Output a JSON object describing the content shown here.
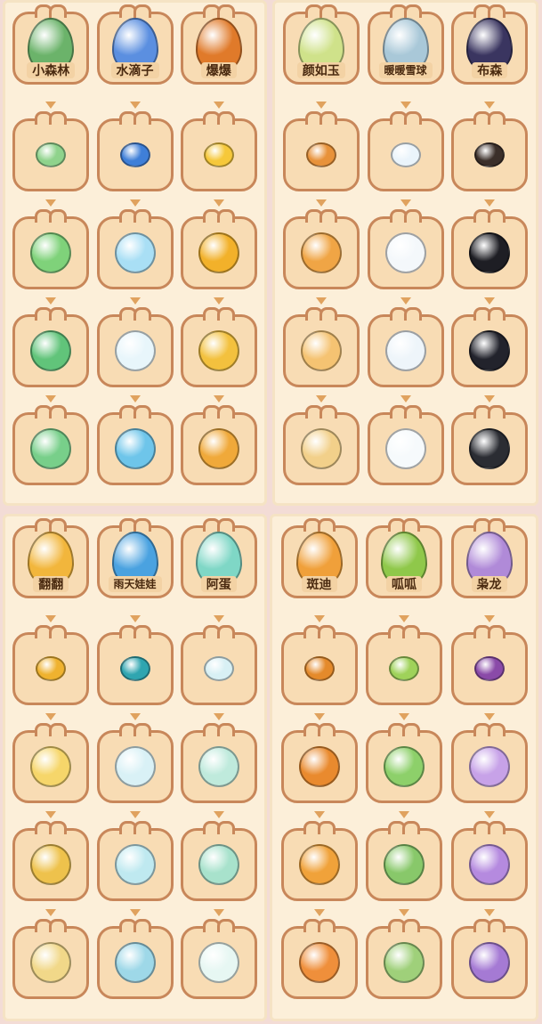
{
  "colors": {
    "background": "#f3dcd6",
    "panel": "#fcefd9",
    "cell_fill": "#f8dcb4",
    "cell_border": "#c8875a",
    "arrow": "#e0a25e"
  },
  "panels": [
    {
      "columns": [
        {
          "name": "小森林",
          "stages": [
            {
              "icon": "forest-egg-icon",
              "color": "#6bb36a"
            },
            {
              "icon": "leaf-seed-icon",
              "color": "#8fd38c"
            },
            {
              "icon": "fluffy-green-sprite-icon",
              "color": "#7fd27a"
            },
            {
              "icon": "horned-green-sprite-icon",
              "color": "#61c47a"
            },
            {
              "icon": "winged-green-sprite-icon",
              "color": "#78cf8a"
            }
          ]
        },
        {
          "name": "水滴子",
          "stages": [
            {
              "icon": "water-egg-icon",
              "color": "#5b8fe0"
            },
            {
              "icon": "blue-droplet-icon",
              "color": "#3f7fd8"
            },
            {
              "icon": "white-whale-icon",
              "color": "#a9dff5"
            },
            {
              "icon": "white-rabbit-scarf-icon",
              "color": "#e8f6fb"
            },
            {
              "icon": "rabbit-on-cloud-icon",
              "color": "#6ec5ea"
            }
          ]
        },
        {
          "name": "爆爆",
          "stages": [
            {
              "icon": "fire-egg-icon",
              "color": "#e07a2a"
            },
            {
              "icon": "yellow-pebble-icon",
              "color": "#f6c83a"
            },
            {
              "icon": "yellow-chick-icon",
              "color": "#f2b12a"
            },
            {
              "icon": "yellow-dragon-icon",
              "color": "#f3c13e"
            },
            {
              "icon": "winged-yellow-dragon-icon",
              "color": "#f0a93a"
            }
          ]
        }
      ]
    },
    {
      "columns": [
        {
          "name": "颜如玉",
          "stages": [
            {
              "icon": "jade-egg-icon",
              "color": "#cfe28a"
            },
            {
              "icon": "closed-book-icon",
              "color": "#e8923a"
            },
            {
              "icon": "winged-book-sprite-icon",
              "color": "#f0a545"
            },
            {
              "icon": "book-fairy-icon",
              "color": "#f5c372"
            },
            {
              "icon": "angel-book-icon",
              "color": "#f2d08a"
            }
          ]
        },
        {
          "name": "暖暖雪球",
          "stages": [
            {
              "icon": "snow-egg-icon",
              "color": "#a9c8d8"
            },
            {
              "icon": "snow-spotted-egg-icon",
              "color": "#eaf4fb"
            },
            {
              "icon": "snowman-head-icon",
              "color": "#f4f8fb"
            },
            {
              "icon": "snowman-icon",
              "color": "#eef5fa"
            },
            {
              "icon": "snowman-scarf-icon",
              "color": "#f6fafc"
            }
          ]
        },
        {
          "name": "布森",
          "stages": [
            {
              "icon": "dark-egg-icon",
              "color": "#3a3560"
            },
            {
              "icon": "dark-button-icon",
              "color": "#3b2f2a"
            },
            {
              "icon": "skull-witch-hat-icon",
              "color": "#1e1e24"
            },
            {
              "icon": "ghost-witch-icon",
              "color": "#22232c"
            },
            {
              "icon": "skeleton-wizard-icon",
              "color": "#2b2d33"
            }
          ]
        }
      ]
    },
    {
      "columns": [
        {
          "name": "翻翻",
          "stages": [
            {
              "icon": "golden-egg-icon",
              "color": "#f2b63c"
            },
            {
              "icon": "gold-coin-icon",
              "color": "#efb22f"
            },
            {
              "icon": "yellow-bee-icon",
              "color": "#f6d66a"
            },
            {
              "icon": "bee-on-leaf-icon",
              "color": "#eec24c"
            },
            {
              "icon": "bee-fairy-icon",
              "color": "#f1d889"
            }
          ]
        },
        {
          "name": "雨天娃娃",
          "stages": [
            {
              "icon": "rain-egg-icon",
              "color": "#4aa2e0"
            },
            {
              "icon": "jelly-cap-icon",
              "color": "#2fa5b0"
            },
            {
              "icon": "rain-ghost-icon",
              "color": "#d9f1f6"
            },
            {
              "icon": "umbrella-doll-icon",
              "color": "#bfe9f0"
            },
            {
              "icon": "rain-umbrella-doll-icon",
              "color": "#9ed8e8"
            }
          ]
        },
        {
          "name": "阿蛋",
          "stages": [
            {
              "icon": "swirl-egg-icon",
              "color": "#7fd7c6"
            },
            {
              "icon": "cloud-puff-icon",
              "color": "#d8f0f4"
            },
            {
              "icon": "cloud-dragon-icon",
              "color": "#bfeadc"
            },
            {
              "icon": "sky-dragon-icon",
              "color": "#a8e2cc"
            },
            {
              "icon": "cloud-cat-icon",
              "color": "#e7f7f3"
            }
          ]
        }
      ]
    },
    {
      "columns": [
        {
          "name": "斑迪",
          "stages": [
            {
              "icon": "spotted-egg-icon",
              "color": "#f0a03a"
            },
            {
              "icon": "orange-star-icon",
              "color": "#e48a2b"
            },
            {
              "icon": "spiky-fox-icon",
              "color": "#e98a2e"
            },
            {
              "icon": "lightning-fox-icon",
              "color": "#f0a23a"
            },
            {
              "icon": "orange-cat-warrior-icon",
              "color": "#ef8f3b"
            }
          ]
        },
        {
          "name": "呱呱",
          "stages": [
            {
              "icon": "green-egg-icon",
              "color": "#8fc84a"
            },
            {
              "icon": "green-spiral-icon",
              "color": "#9fd25a"
            },
            {
              "icon": "sprout-frog-icon",
              "color": "#8dd06a"
            },
            {
              "icon": "crowned-frog-icon",
              "color": "#88c86a"
            },
            {
              "icon": "frog-prince-icon",
              "color": "#9fd07a"
            }
          ]
        },
        {
          "name": "枭龙",
          "stages": [
            {
              "icon": "purple-egg-icon",
              "color": "#b08ad8"
            },
            {
              "icon": "purple-sphere-icon",
              "color": "#8a4aa8"
            },
            {
              "icon": "purple-ghost-icon",
              "color": "#c7a2e8"
            },
            {
              "icon": "purple-serpent-icon",
              "color": "#b58adf"
            },
            {
              "icon": "purple-dragon-icon",
              "color": "#a57ad4"
            }
          ]
        }
      ]
    }
  ]
}
